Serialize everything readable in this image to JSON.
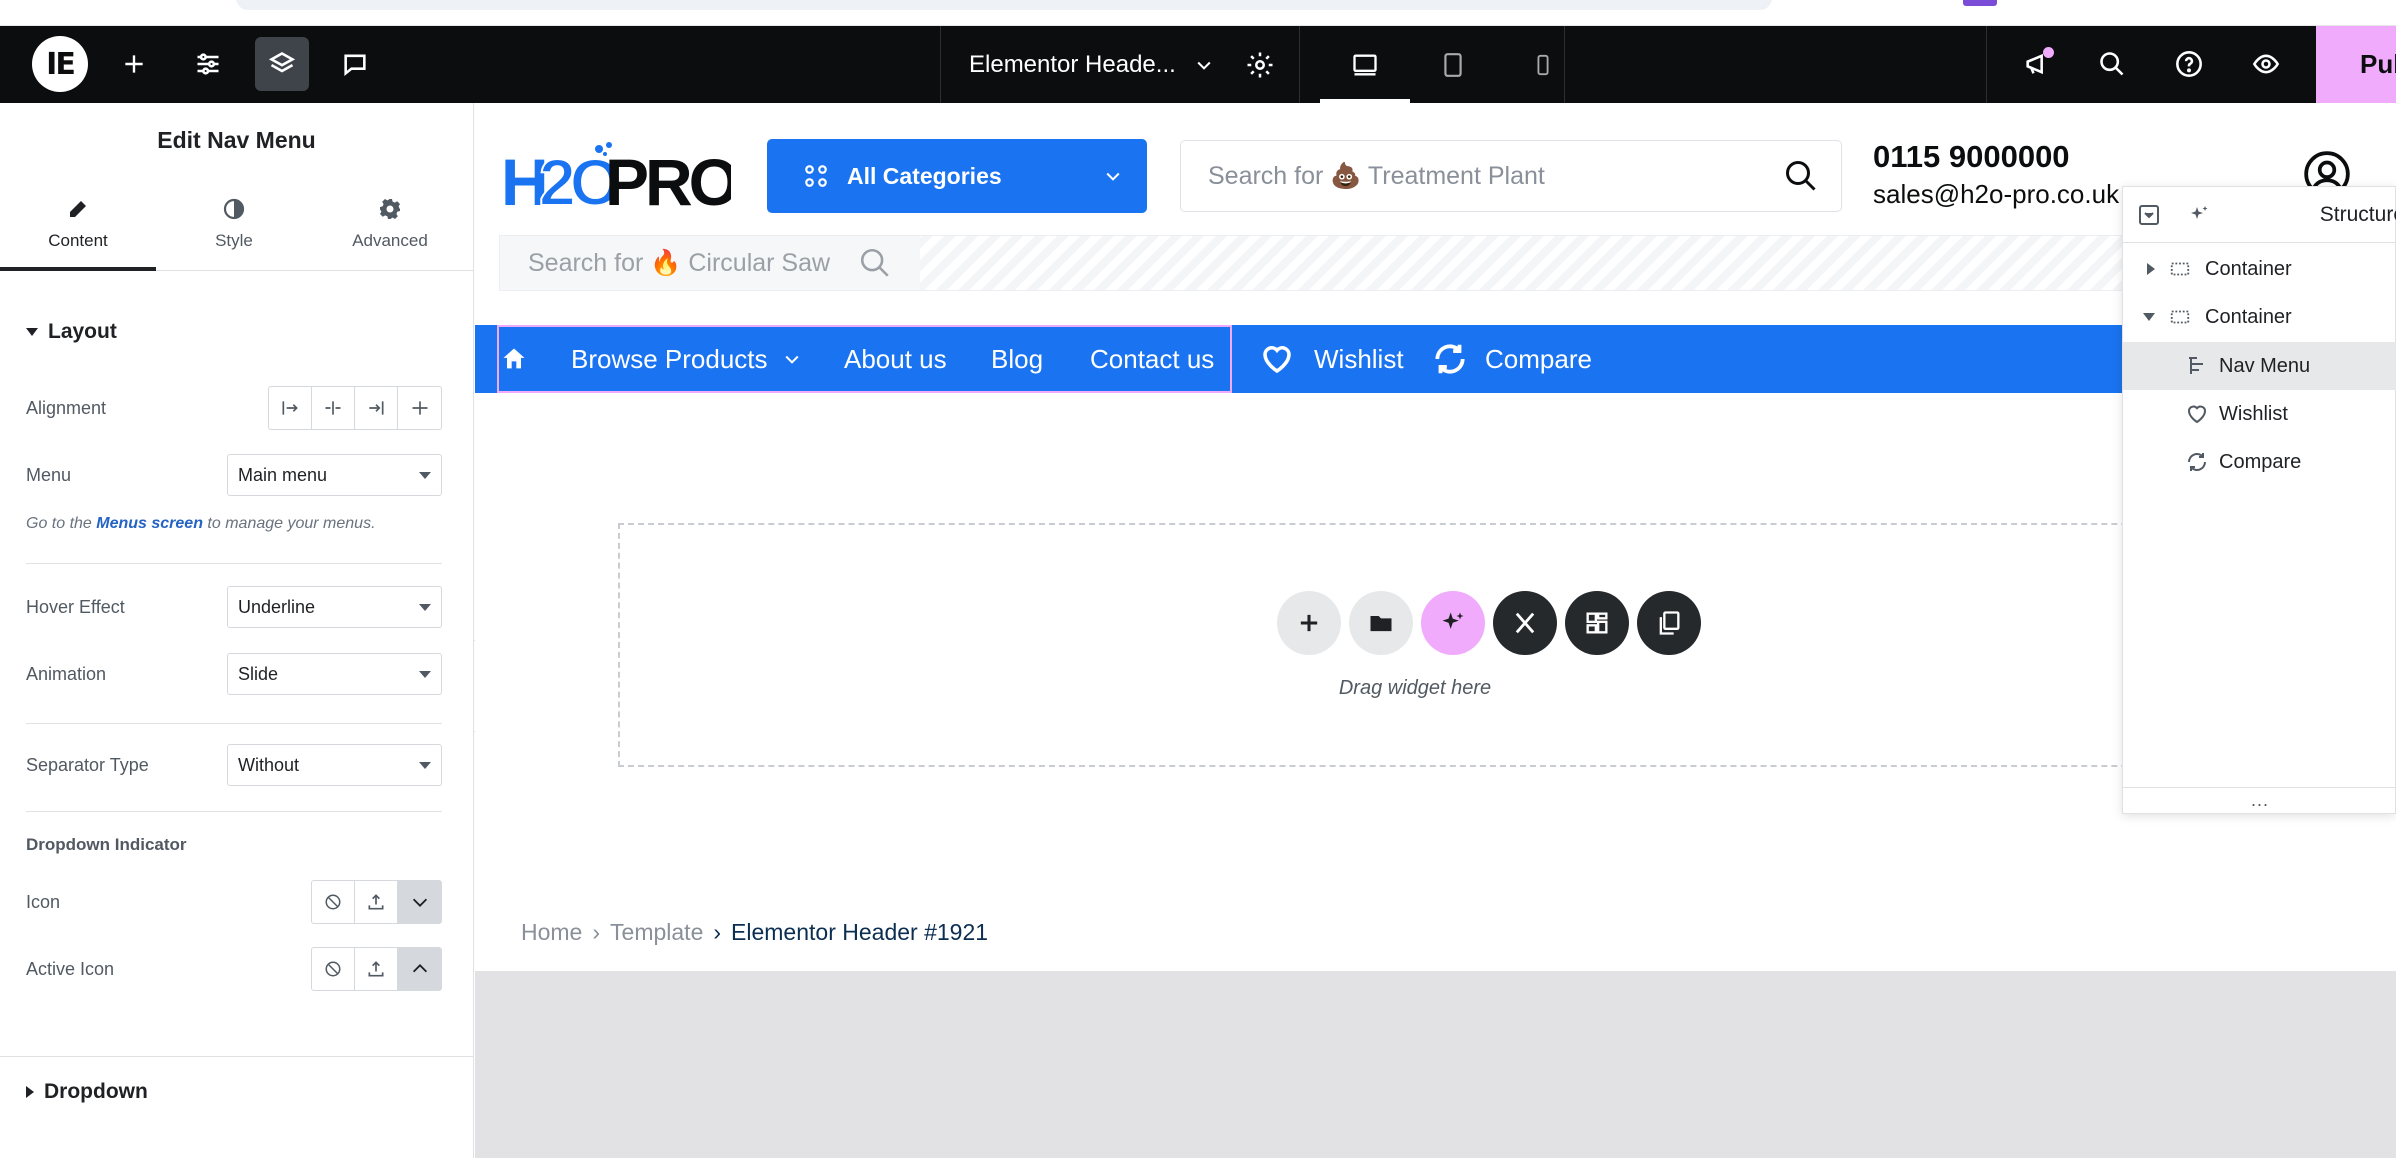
{
  "topbar": {
    "document_title": "Elementor Heade...",
    "publish_label": "Pub"
  },
  "panel": {
    "title": "Edit Nav Menu",
    "tabs": [
      {
        "label": "Content"
      },
      {
        "label": "Style"
      },
      {
        "label": "Advanced"
      }
    ],
    "layout": {
      "section_title": "Layout",
      "alignment_label": "Alignment",
      "menu_label": "Menu",
      "menu_value": "Main menu",
      "hint_prefix": "Go to the ",
      "hint_link": "Menus screen",
      "hint_suffix": " to manage your menus.",
      "hover_label": "Hover Effect",
      "hover_value": "Underline",
      "animation_label": "Animation",
      "animation_value": "Slide",
      "separator_label": "Separator Type",
      "separator_value": "Without",
      "dropdown_indicator_title": "Dropdown Indicator",
      "icon_label": "Icon",
      "active_icon_label": "Active Icon"
    },
    "dropdown_section_title": "Dropdown"
  },
  "site": {
    "logo_text_1": "H",
    "logo_text_2": "2O",
    "logo_text_3": "PRO",
    "categories_label": "All Categories",
    "search_placeholder": "Search for 💩 Treatment Plant",
    "phone": "0115 9000000",
    "email": "sales@h2o-pro.co.uk",
    "mini_search_placeholder": "Search for 🔥 Circular Saw",
    "nav": {
      "browse": "Browse Products",
      "about": "About us",
      "blog": "Blog",
      "contact": "Contact us",
      "wishlist": "Wishlist",
      "compare": "Compare"
    },
    "drop_zone_text": "Drag widget here",
    "breadcrumbs": {
      "home": "Home",
      "template": "Template",
      "current": "Elementor Header #1921"
    }
  },
  "structure": {
    "title": "Structure",
    "items": [
      {
        "label": "Container"
      },
      {
        "label": "Container"
      },
      {
        "label": "Nav Menu"
      },
      {
        "label": "Wishlist"
      },
      {
        "label": "Compare"
      }
    ],
    "footer": "..."
  },
  "colors": {
    "accent_pink": "#f0abfc",
    "site_blue": "#1a73f0",
    "topbar_bg": "#0c0d0e"
  }
}
